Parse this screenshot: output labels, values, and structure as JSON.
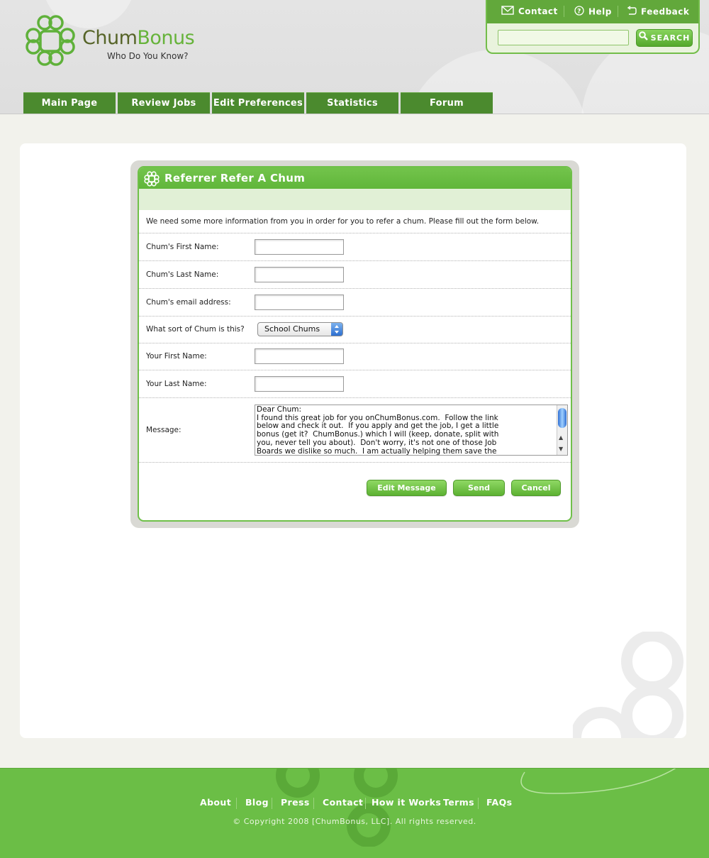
{
  "brand": {
    "name_part1": "Chum",
    "name_part2": "Bonus",
    "tagline": "Who Do You Know?",
    "colors": {
      "green": "#6bbe46",
      "dark_green": "#4b8a2e",
      "olive": "#566428"
    }
  },
  "toolbox": {
    "links": [
      {
        "label": "Contact",
        "icon": "envelope-icon"
      },
      {
        "label": "Help",
        "icon": "question-circle-icon"
      },
      {
        "label": "Feedback",
        "icon": "undo-arrow-icon"
      }
    ],
    "search_value": "",
    "search_button": "SEARCH"
  },
  "nav": {
    "tabs": [
      "Main Page",
      "Review Jobs",
      "Edit Preferences",
      "Statistics",
      "Forum"
    ]
  },
  "form": {
    "title": "Referrer Refer A Chum",
    "intro": "We need some more information from you in order for you to refer a chum. Please fill out the form below.",
    "fields": {
      "chum_first_name": {
        "label": "Chum's First Name:",
        "value": ""
      },
      "chum_last_name": {
        "label": "Chum's Last Name:",
        "value": ""
      },
      "chum_email": {
        "label": "Chum's email address:",
        "value": ""
      },
      "chum_type": {
        "label": "What sort of Chum is this?",
        "selected": "School Chums"
      },
      "your_first_name": {
        "label": "Your First Name:",
        "value": ""
      },
      "your_last_name": {
        "label": "Your Last Name:",
        "value": ""
      },
      "message": {
        "label": "Message:",
        "value": "Dear Chum:\nI found this great job for you onChumBonus.com.  Follow the link\nbelow and check it out.  If you apply and get the job, I get a little\nbonus (get it?  ChumBonus.) which I will (keep, donate, split with\nyou, never tell you about).  Don't worry, it's not one of those Job\nBoards we dislike so much.  I am actually helping them save the"
      }
    },
    "buttons": {
      "edit": "Edit Message",
      "send": "Send",
      "cancel": "Cancel"
    }
  },
  "footer": {
    "links": [
      "About",
      "Blog",
      "Press",
      "Contact",
      "How it Works",
      "Terms",
      "FAQs"
    ],
    "copyright": "© Copyright 2008 [ChumBonus, LLC]. All rights reserved."
  }
}
